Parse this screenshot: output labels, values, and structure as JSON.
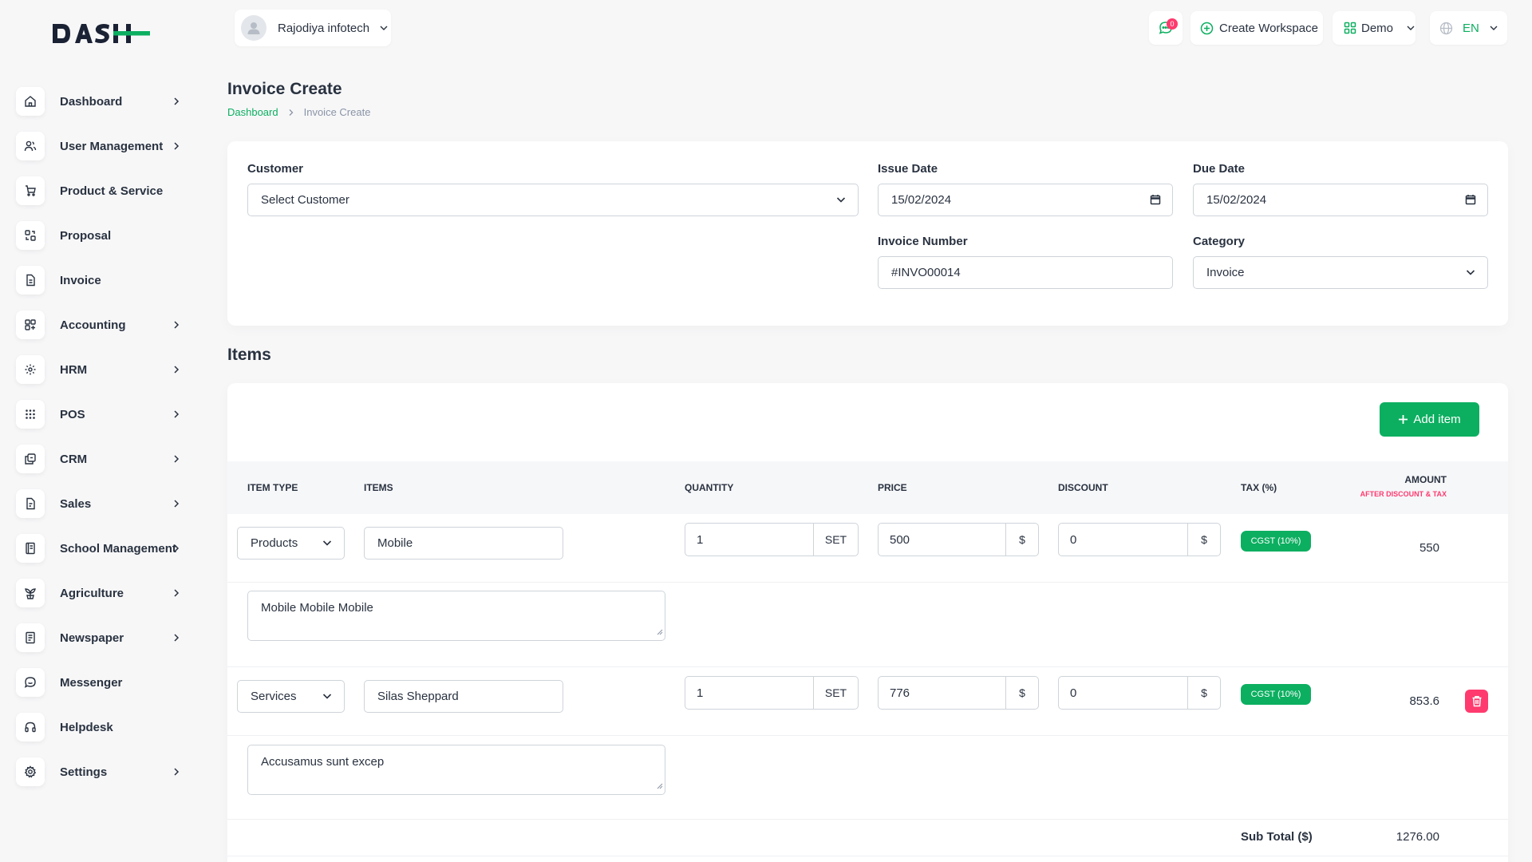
{
  "brand": {
    "logo_text": "DASH"
  },
  "sidebar": {
    "items": [
      {
        "label": "Dashboard",
        "has_chevron": true
      },
      {
        "label": "User Management",
        "has_chevron": true
      },
      {
        "label": "Product & Service",
        "has_chevron": false
      },
      {
        "label": "Proposal",
        "has_chevron": false
      },
      {
        "label": "Invoice",
        "has_chevron": false
      },
      {
        "label": "Accounting",
        "has_chevron": true
      },
      {
        "label": "HRM",
        "has_chevron": true
      },
      {
        "label": "POS",
        "has_chevron": true
      },
      {
        "label": "CRM",
        "has_chevron": true
      },
      {
        "label": "Sales",
        "has_chevron": true
      },
      {
        "label": "School Management",
        "has_chevron": true
      },
      {
        "label": "Agriculture",
        "has_chevron": true
      },
      {
        "label": "Newspaper",
        "has_chevron": true
      },
      {
        "label": "Messenger",
        "has_chevron": false
      },
      {
        "label": "Helpdesk",
        "has_chevron": false
      },
      {
        "label": "Settings",
        "has_chevron": true
      }
    ]
  },
  "header": {
    "workspace_name": "Rajodiya infotech",
    "notification_count": "0",
    "create_workspace": "Create Workspace",
    "demo": "Demo",
    "language": "EN"
  },
  "page": {
    "title": "Invoice Create",
    "breadcrumb_home": "Dashboard",
    "breadcrumb_current": "Invoice Create"
  },
  "form": {
    "customer_label": "Customer",
    "customer_value": "Select Customer",
    "issue_date_label": "Issue Date",
    "issue_date_value": "15/02/2024",
    "due_date_label": "Due Date",
    "due_date_value": "15/02/2024",
    "invoice_number_label": "Invoice Number",
    "invoice_number_value": "#INVO00014",
    "category_label": "Category",
    "category_value": "Invoice"
  },
  "items": {
    "title": "Items",
    "add_label": "Add item",
    "columns": {
      "item_type": "ITEM TYPE",
      "items": "ITEMS",
      "quantity": "QUANTITY",
      "price": "PRICE",
      "discount": "DISCOUNT",
      "tax": "TAX (%)",
      "amount": "AMOUNT",
      "amount_sub": "AFTER DISCOUNT & TAX"
    },
    "rows": [
      {
        "type": "Products",
        "item": "Mobile",
        "quantity": "1",
        "unit": "SET",
        "price": "500",
        "currency": "$",
        "discount": "0",
        "tax": "CGST (10%)",
        "amount": "550",
        "description": "Mobile Mobile Mobile"
      },
      {
        "type": "Services",
        "item": "Silas Sheppard",
        "quantity": "1",
        "unit": "SET",
        "price": "776",
        "currency": "$",
        "discount": "0",
        "tax": "CGST (10%)",
        "amount": "853.6",
        "description": "Accusamus sunt excep"
      }
    ],
    "subtotal_label": "Sub Total ($)",
    "subtotal_value": "1276.00"
  },
  "colors": {
    "accent": "#0caf60",
    "danger": "#ff3a6e",
    "text": "#293240"
  }
}
